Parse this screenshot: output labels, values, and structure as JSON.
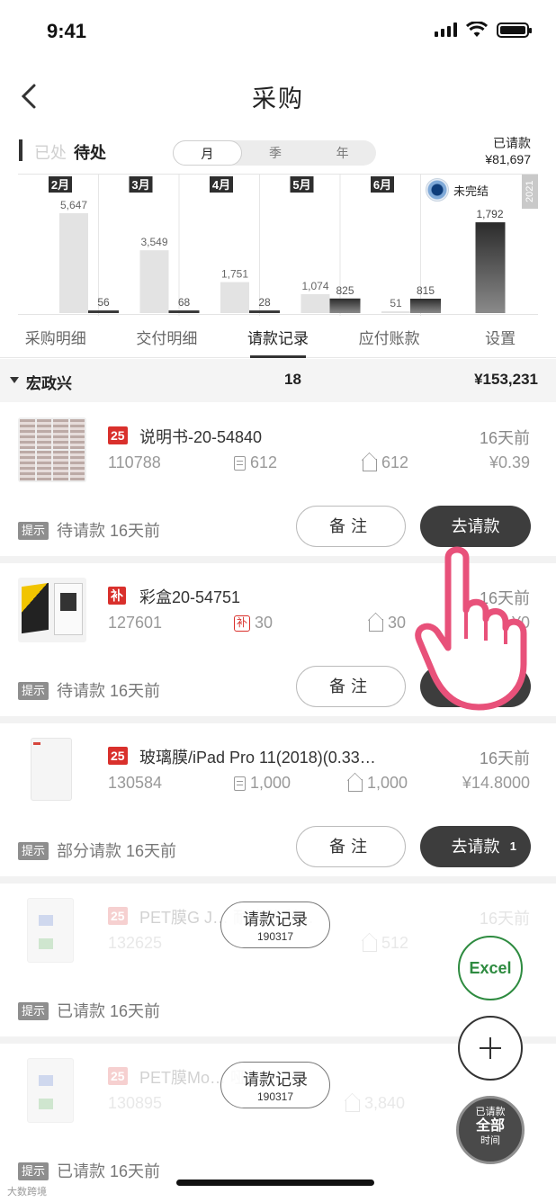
{
  "status": {
    "time": "9:41"
  },
  "nav": {
    "title": "采购",
    "back_icon": "chevron-left-icon"
  },
  "filter": {
    "done_label": "已处",
    "pending_label": "待处",
    "periods": [
      "月",
      "季",
      "年"
    ],
    "active_period": "月",
    "requested_label": "已请款",
    "requested_amount": "¥81,697"
  },
  "chart_data": {
    "type": "bar",
    "year_label": "2021",
    "legend_unfinished": "未完结",
    "categories": [
      "2月",
      "3月",
      "4月",
      "5月",
      "6月",
      "未完结"
    ],
    "series": [
      {
        "values": [
          5647,
          3549,
          1751,
          1074,
          51,
          1792
        ]
      },
      {
        "values": [
          56,
          68,
          28,
          825,
          815,
          null
        ]
      }
    ],
    "labels_light": [
      "5,647",
      "3,549",
      "1,751",
      "1,074",
      "51",
      "1,792"
    ],
    "labels_dark": [
      "56",
      "68",
      "28",
      "825",
      "815",
      ""
    ],
    "ylim": [
      0,
      6000
    ]
  },
  "tabs": [
    "采购明细",
    "交付明细",
    "请款记录",
    "应付账款",
    "设置"
  ],
  "active_tab": "请款记录",
  "supplier": {
    "name": "宏政兴",
    "count": "18",
    "total": "¥153,231"
  },
  "cards": [
    {
      "badge": "25",
      "title": "说明书-20-54840",
      "age": "16天前",
      "code": "110788",
      "qty1": "612",
      "qty2": "612",
      "price": "¥0.39",
      "hint_tag": "提示",
      "hint": "待请款 16天前",
      "note_label": "备注",
      "request_label": "去请款",
      "request_count": ""
    },
    {
      "badge": "补",
      "title": "彩盒20-54751",
      "age": "16天前",
      "code": "127601",
      "qty1": "30",
      "qty2": "30",
      "price": "¥0",
      "hint_tag": "提示",
      "hint": "待请款 16天前",
      "note_label": "备注",
      "request_label": "去请款",
      "request_count": ""
    },
    {
      "badge": "25",
      "title": "玻璃膜/iPad Pro 11(2018)(0.33…",
      "age": "16天前",
      "code": "130584",
      "qty1": "1,000",
      "qty2": "1,000",
      "price": "¥14.8000",
      "hint_tag": "提示",
      "hint": "部分请款  16天前",
      "note_label": "备注",
      "request_label": "去请款",
      "request_count": "1"
    },
    {
      "badge": "25",
      "title": "PET膜G J…  耐磨防刮…",
      "age": "16天前",
      "code": "132625",
      "qty1": "",
      "qty2": "512",
      "price": "",
      "hint_tag": "提示",
      "hint": "已请款  16天前",
      "stamp_label": "请款记录",
      "stamp_date": "190317"
    },
    {
      "badge": "25",
      "title": "PET膜Mo…  哑标/1…",
      "age": "",
      "code": "130895",
      "qty1": "",
      "qty2": "3,840",
      "price": "",
      "hint_tag": "提示",
      "hint": "已请款  16天前",
      "stamp_label": "请款记录",
      "stamp_date": "190317"
    }
  ],
  "fab": {
    "excel": "Excel",
    "filter_top": "已请款",
    "filter_main": "全部",
    "filter_bottom": "时间"
  },
  "watermark": "大数跨境"
}
